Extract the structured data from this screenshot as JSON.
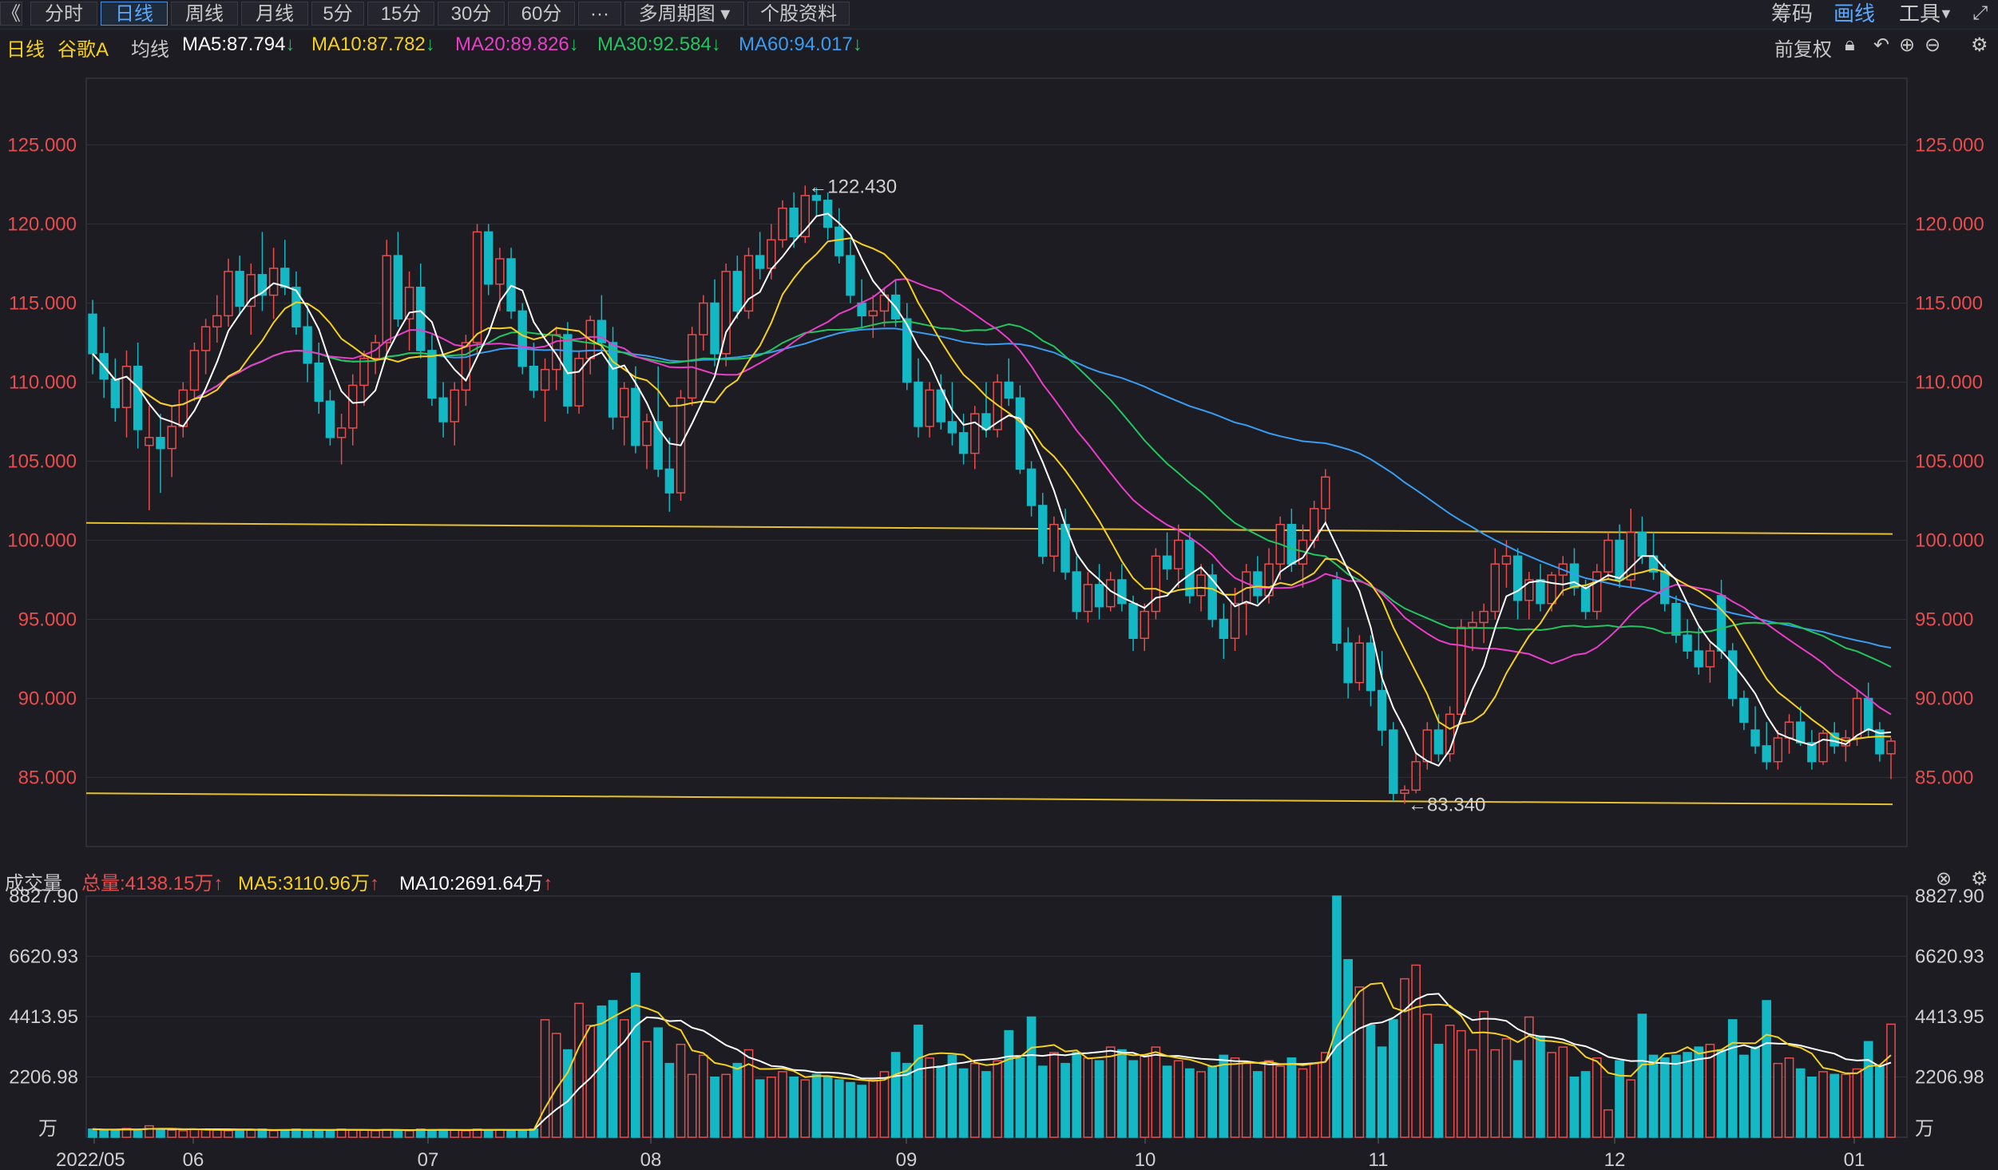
{
  "toolbar": {
    "back_glyph": "《",
    "periods": [
      "分时",
      "日线",
      "周线",
      "月线",
      "5分",
      "15分",
      "30分",
      "60分",
      "···",
      "多周期图",
      "个股资料"
    ],
    "active_period": "日线",
    "right_items": [
      "筹码",
      "画线",
      "工具"
    ]
  },
  "info": {
    "period": "日线",
    "stock_name": "谷歌A",
    "ma_label": "均线",
    "ma5": "MA5:87.794",
    "ma10": "MA10:87.782",
    "ma20": "MA20:89.826",
    "ma30": "MA30:92.584",
    "ma60": "MA60:94.017",
    "adjust": "前复权"
  },
  "volume_bar": {
    "title": "成交量",
    "total": "总量:4138.15万",
    "ma5": "MA5:3110.96万",
    "ma10": "MA10:2691.64万"
  },
  "colors": {
    "up": "#e84d4d",
    "down": "#14b8c4",
    "ma5": "#ffffff",
    "ma10": "#f5d020",
    "ma20": "#e83ec8",
    "ma30": "#22c55e",
    "ma60": "#3a9cf0",
    "trend": "#e8c030",
    "axis_price": "#e84d4d",
    "axis_volume": "#d0d0d0",
    "grid": "#2e3038"
  },
  "chart_data": [
    {
      "type": "candlestick",
      "title": "谷歌A 日线",
      "ylim": [
        80,
        130
      ],
      "y_ticks": [
        "125.000",
        "120.000",
        "115.000",
        "110.000",
        "105.000",
        "100.000",
        "95.000",
        "90.000",
        "85.000"
      ],
      "x_ticks": [
        "2022/05",
        "06",
        "07",
        "08",
        "09",
        "10",
        "11",
        "12",
        "01"
      ],
      "annotations": [
        {
          "text": "←122.430",
          "value": 122.43
        },
        {
          "text": "←83.340",
          "value": 83.34
        }
      ],
      "ohlc": [
        [
          114.3,
          115.2,
          110.5,
          111.8
        ],
        [
          111.8,
          113.5,
          109.0,
          110.2
        ],
        [
          110.2,
          111.5,
          107.5,
          108.4
        ],
        [
          108.4,
          112.0,
          106.5,
          111.0
        ],
        [
          111.0,
          112.5,
          105.8,
          107.0
        ],
        [
          106.0,
          108.5,
          101.9,
          106.5
        ],
        [
          106.5,
          108.0,
          103.0,
          105.8
        ],
        [
          105.8,
          108.5,
          104.0,
          107.2
        ],
        [
          107.2,
          110.0,
          106.5,
          109.5
        ],
        [
          109.5,
          112.5,
          108.8,
          112.0
        ],
        [
          112.0,
          114.0,
          110.5,
          113.5
        ],
        [
          113.5,
          115.5,
          112.5,
          114.2
        ],
        [
          114.2,
          117.8,
          113.5,
          117.0
        ],
        [
          117.0,
          118.0,
          114.2,
          114.8
        ],
        [
          114.8,
          117.5,
          113.0,
          116.8
        ],
        [
          116.8,
          119.5,
          114.5,
          115.5
        ],
        [
          115.5,
          118.5,
          114.0,
          117.2
        ],
        [
          117.2,
          119.0,
          115.5,
          116.0
        ],
        [
          116.0,
          117.0,
          113.0,
          113.5
        ],
        [
          113.5,
          115.0,
          110.0,
          111.2
        ],
        [
          111.2,
          112.5,
          108.0,
          108.8
        ],
        [
          108.8,
          109.5,
          106.0,
          106.5
        ],
        [
          106.5,
          108.0,
          104.8,
          107.1
        ],
        [
          107.1,
          110.5,
          106.0,
          109.8
        ],
        [
          109.8,
          112.0,
          108.5,
          111.5
        ],
        [
          111.5,
          113.0,
          110.5,
          112.5
        ],
        [
          112.5,
          119.0,
          111.5,
          118.0
        ],
        [
          118.0,
          119.5,
          113.5,
          114.0
        ],
        [
          114.0,
          117.0,
          112.0,
          116.0
        ],
        [
          116.0,
          117.5,
          111.5,
          112.0
        ],
        [
          112.0,
          113.0,
          108.5,
          109.0
        ],
        [
          109.0,
          110.0,
          106.5,
          107.5
        ],
        [
          107.5,
          110.0,
          106.0,
          109.5
        ],
        [
          109.5,
          113.0,
          108.5,
          112.5
        ],
        [
          112.5,
          120.0,
          111.8,
          119.5
        ],
        [
          119.5,
          120.0,
          115.5,
          116.2
        ],
        [
          116.2,
          118.5,
          114.5,
          117.8
        ],
        [
          117.8,
          118.5,
          114.0,
          114.5
        ],
        [
          114.5,
          115.0,
          110.5,
          111.0
        ],
        [
          111.0,
          112.5,
          109.0,
          109.5
        ],
        [
          109.5,
          111.5,
          107.5,
          110.8
        ],
        [
          110.8,
          113.5,
          109.5,
          113.0
        ],
        [
          113.0,
          113.8,
          108.0,
          108.5
        ],
        [
          108.5,
          112.0,
          108.0,
          111.5
        ],
        [
          111.5,
          114.2,
          110.5,
          113.9
        ],
        [
          113.9,
          115.5,
          112.0,
          112.5
        ],
        [
          112.5,
          113.5,
          107.0,
          107.8
        ],
        [
          107.8,
          110.0,
          106.0,
          109.6
        ],
        [
          109.6,
          111.0,
          105.5,
          106.0
        ],
        [
          106.0,
          108.0,
          104.5,
          107.5
        ],
        [
          107.5,
          111.0,
          104.0,
          104.5
        ],
        [
          104.5,
          106.5,
          101.8,
          103.0
        ],
        [
          103.0,
          109.5,
          102.5,
          109.0
        ],
        [
          109.0,
          113.5,
          108.5,
          113.0
        ],
        [
          113.0,
          115.5,
          112.0,
          115.0
        ],
        [
          115.0,
          116.5,
          111.0,
          111.8
        ],
        [
          111.8,
          117.5,
          111.0,
          117.0
        ],
        [
          117.0,
          118.0,
          114.0,
          114.5
        ],
        [
          114.5,
          118.5,
          114.0,
          118.0
        ],
        [
          118.0,
          119.5,
          116.5,
          117.2
        ],
        [
          117.2,
          120.0,
          116.5,
          119.0
        ],
        [
          119.0,
          121.5,
          118.5,
          121.0
        ],
        [
          121.0,
          122.0,
          118.5,
          119.2
        ],
        [
          119.2,
          122.43,
          118.8,
          121.8
        ],
        [
          121.8,
          122.3,
          120.5,
          121.5
        ],
        [
          121.5,
          122.0,
          119.0,
          119.8
        ],
        [
          119.8,
          121.0,
          117.5,
          118.0
        ],
        [
          118.0,
          119.0,
          115.0,
          115.5
        ],
        [
          115.0,
          116.5,
          113.5,
          114.2
        ],
        [
          114.2,
          115.5,
          112.8,
          114.5
        ],
        [
          114.5,
          116.0,
          113.5,
          115.5
        ],
        [
          115.5,
          116.5,
          113.5,
          114.0
        ],
        [
          114.0,
          115.0,
          109.5,
          110.0
        ],
        [
          110.0,
          111.5,
          106.5,
          107.2
        ],
        [
          107.2,
          110.0,
          106.5,
          109.5
        ],
        [
          109.5,
          110.5,
          107.0,
          107.5
        ],
        [
          107.5,
          110.0,
          106.0,
          106.8
        ],
        [
          106.8,
          108.0,
          104.8,
          105.5
        ],
        [
          105.5,
          108.5,
          104.5,
          108.0
        ],
        [
          108.0,
          110.0,
          106.5,
          107.0
        ],
        [
          107.0,
          110.5,
          106.5,
          110.0
        ],
        [
          110.0,
          111.5,
          108.5,
          109.0
        ],
        [
          109.0,
          109.8,
          104.2,
          104.5
        ],
        [
          104.5,
          105.0,
          101.5,
          102.2
        ],
        [
          102.2,
          103.0,
          98.5,
          99.0
        ],
        [
          99.0,
          101.5,
          98.0,
          101.0
        ],
        [
          101.0,
          102.0,
          97.5,
          98.0
        ],
        [
          98.0,
          99.0,
          95.0,
          95.5
        ],
        [
          95.5,
          98.0,
          94.8,
          97.2
        ],
        [
          97.2,
          98.5,
          95.0,
          95.8
        ],
        [
          95.8,
          98.0,
          95.5,
          97.5
        ],
        [
          97.5,
          98.5,
          95.5,
          96.0
        ],
        [
          96.0,
          96.5,
          93.0,
          93.8
        ],
        [
          93.8,
          96.0,
          93.0,
          95.5
        ],
        [
          95.5,
          99.5,
          95.0,
          99.0
        ],
        [
          99.0,
          100.5,
          97.5,
          98.2
        ],
        [
          98.2,
          101.0,
          97.0,
          100.0
        ],
        [
          100.0,
          100.5,
          96.0,
          96.5
        ],
        [
          96.5,
          98.5,
          95.5,
          97.8
        ],
        [
          97.8,
          98.5,
          94.5,
          95.0
        ],
        [
          95.0,
          96.0,
          92.5,
          93.8
        ],
        [
          93.8,
          97.0,
          93.0,
          96.0
        ],
        [
          96.0,
          98.5,
          94.0,
          98.0
        ],
        [
          98.0,
          99.0,
          96.0,
          96.5
        ],
        [
          96.5,
          99.5,
          96.0,
          98.5
        ],
        [
          98.5,
          101.5,
          97.5,
          101.0
        ],
        [
          101.0,
          102.0,
          98.0,
          98.5
        ],
        [
          98.5,
          101.0,
          97.0,
          100.0
        ],
        [
          100.0,
          102.5,
          99.5,
          102.0
        ],
        [
          102.0,
          104.5,
          101.0,
          104.0
        ],
        [
          97.5,
          98.0,
          93.0,
          93.5
        ],
        [
          93.5,
          94.5,
          90.0,
          91.0
        ],
        [
          91.0,
          94.0,
          90.5,
          93.5
        ],
        [
          93.5,
          94.0,
          89.5,
          90.5
        ],
        [
          90.5,
          93.0,
          87.0,
          88.0
        ],
        [
          88.0,
          88.5,
          83.5,
          84.0
        ],
        [
          84.0,
          84.5,
          83.34,
          84.2
        ],
        [
          84.2,
          86.5,
          84.0,
          86.0
        ],
        [
          86.0,
          88.5,
          85.5,
          88.0
        ],
        [
          88.0,
          89.0,
          86.0,
          86.5
        ],
        [
          86.5,
          89.5,
          86.0,
          89.0
        ],
        [
          89.0,
          95.0,
          88.5,
          94.5
        ],
        [
          94.5,
          95.5,
          93.0,
          94.8
        ],
        [
          94.8,
          96.0,
          93.5,
          95.5
        ],
        [
          95.5,
          99.5,
          95.0,
          98.5
        ],
        [
          98.5,
          100.0,
          97.0,
          99.0
        ],
        [
          99.0,
          99.5,
          95.0,
          96.2
        ],
        [
          96.2,
          98.0,
          95.0,
          97.5
        ],
        [
          97.5,
          98.5,
          95.5,
          96.0
        ],
        [
          96.0,
          98.0,
          95.5,
          97.8
        ],
        [
          97.8,
          99.0,
          96.5,
          98.5
        ],
        [
          98.5,
          99.5,
          96.5,
          97.0
        ],
        [
          97.0,
          97.5,
          95.0,
          95.5
        ],
        [
          95.5,
          98.5,
          95.0,
          98.0
        ],
        [
          98.0,
          100.5,
          97.5,
          100.0
        ],
        [
          100.0,
          101.0,
          97.0,
          97.5
        ],
        [
          97.5,
          102.0,
          97.0,
          100.5
        ],
        [
          100.5,
          101.5,
          98.5,
          99.0
        ],
        [
          99.0,
          100.5,
          97.5,
          98.0
        ],
        [
          98.0,
          98.5,
          95.5,
          96.0
        ],
        [
          96.0,
          96.5,
          93.5,
          94.0
        ],
        [
          94.0,
          95.0,
          92.5,
          93.0
        ],
        [
          93.0,
          94.5,
          91.5,
          92.0
        ],
        [
          92.0,
          93.5,
          91.0,
          93.0
        ],
        [
          96.5,
          97.5,
          92.5,
          93.0
        ],
        [
          93.0,
          93.5,
          89.5,
          90.0
        ],
        [
          90.0,
          90.5,
          88.0,
          88.5
        ],
        [
          88.0,
          89.5,
          86.5,
          87.0
        ],
        [
          87.0,
          88.5,
          85.5,
          86.0
        ],
        [
          86.0,
          88.0,
          85.5,
          87.5
        ],
        [
          87.5,
          89.0,
          86.5,
          88.5
        ],
        [
          88.5,
          89.5,
          87.0,
          87.2
        ],
        [
          87.2,
          88.0,
          85.5,
          86.0
        ],
        [
          86.0,
          88.0,
          85.8,
          87.8
        ],
        [
          87.8,
          88.5,
          86.5,
          87.0
        ],
        [
          87.0,
          88.0,
          86.0,
          87.5
        ],
        [
          87.5,
          90.5,
          87.0,
          90.0
        ],
        [
          90.0,
          91.0,
          87.5,
          88.0
        ],
        [
          88.0,
          88.5,
          86.0,
          86.5
        ],
        [
          86.5,
          87.5,
          84.9,
          87.3
        ]
      ],
      "trendlines": [
        {
          "from": [
            0,
            101.1
          ],
          "to": [
            159,
            100.4
          ]
        },
        {
          "from": [
            0,
            84.0
          ],
          "to": [
            159,
            83.3
          ]
        }
      ]
    },
    {
      "type": "bar",
      "title": "成交量",
      "unit": "万",
      "ylim": [
        0,
        8827.9
      ],
      "y_ticks": [
        "8827.90",
        "6620.93",
        "4413.95",
        "2206.98",
        "万"
      ],
      "values": [
        300,
        260,
        280,
        320,
        260,
        420,
        300,
        260,
        240,
        280,
        300,
        260,
        240,
        280,
        260,
        300,
        240,
        260,
        300,
        280,
        260,
        240,
        300,
        280,
        260,
        240,
        280,
        260,
        240,
        300,
        260,
        280,
        260,
        240,
        300,
        260,
        280,
        260,
        240,
        300,
        4300,
        3800,
        3200,
        4900,
        4100,
        4800,
        5000,
        4300,
        6000,
        3500,
        4000,
        2700,
        3400,
        2300,
        3000,
        2200,
        2300,
        2700,
        3200,
        2100,
        2200,
        2400,
        2200,
        2100,
        2300,
        2200,
        2100,
        2000,
        1900,
        2100,
        2400,
        3100,
        2700,
        4100,
        2900,
        2600,
        3000,
        2500,
        2700,
        2400,
        2800,
        3900,
        2900,
        4400,
        2600,
        3100,
        2700,
        3100,
        2900,
        2800,
        3300,
        3200,
        2800,
        3000,
        3300,
        2600,
        2800,
        2500,
        2400,
        2600,
        3000,
        2900,
        2700,
        2400,
        2800,
        2600,
        2900,
        2500,
        2700,
        3100,
        8827,
        6500,
        5500,
        4100,
        3300,
        4300,
        5800,
        6300,
        4500,
        3400,
        4100,
        3900,
        3200,
        4600,
        3200,
        3600,
        2800,
        4400,
        3700,
        3100,
        3300,
        2200,
        2400,
        2900,
        1000,
        2800,
        2100,
        4500,
        3000,
        2900,
        3000,
        3100,
        3300,
        3400,
        3200,
        4300,
        3000,
        3300,
        5000,
        2700,
        2900,
        2500,
        2200,
        2400,
        2300,
        2300,
        2500,
        3500,
        2600,
        4138
      ],
      "ma5_approx": true
    }
  ]
}
